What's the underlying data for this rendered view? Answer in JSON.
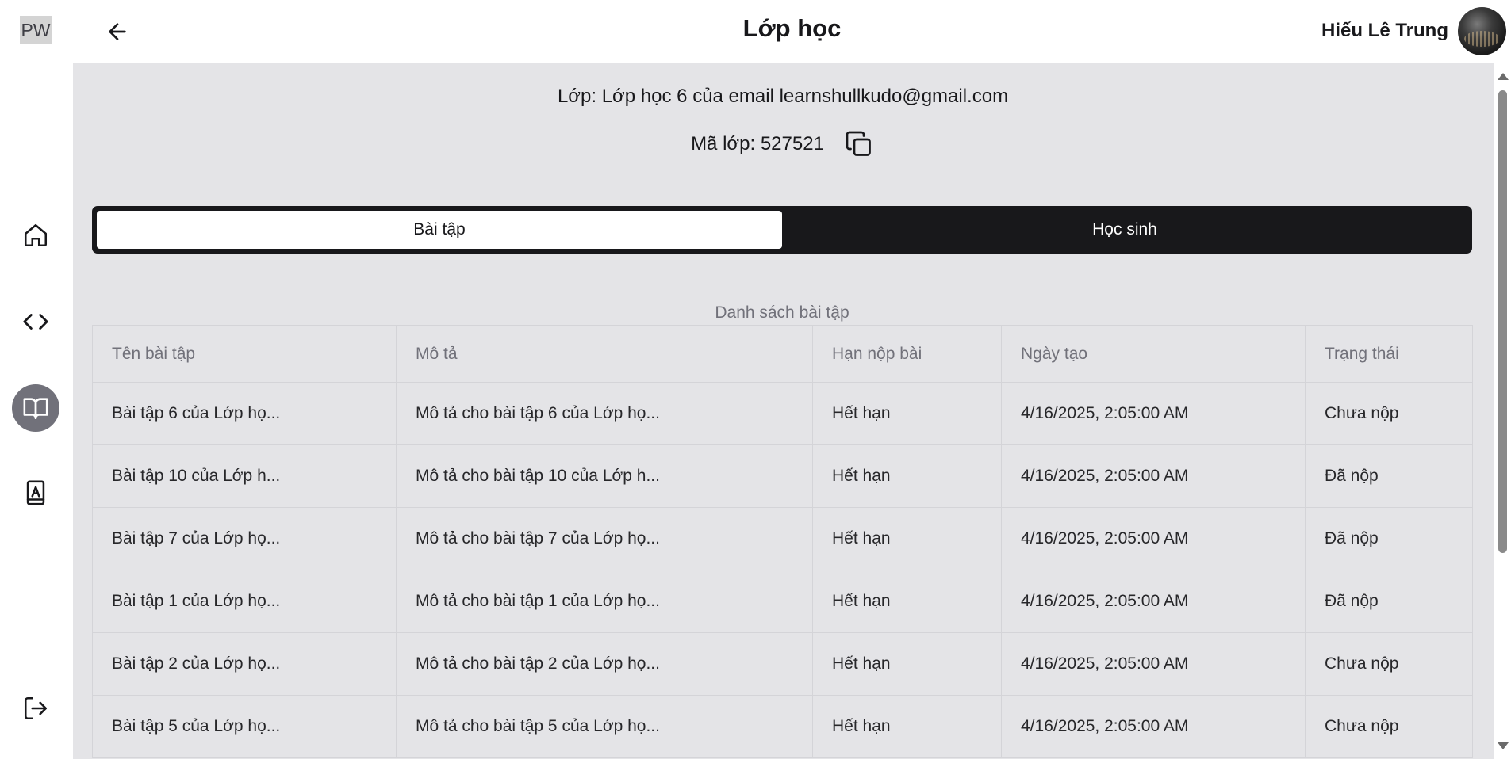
{
  "app": {
    "logo": "PW"
  },
  "header": {
    "title": "Lớp học",
    "user_name": "Hiếu Lê Trung"
  },
  "sidebar": {
    "items": [
      {
        "icon": "home-icon"
      },
      {
        "icon": "code-icon"
      },
      {
        "icon": "book-open-icon",
        "active": true
      },
      {
        "icon": "book-user-icon"
      }
    ],
    "logout_icon": "logout-icon"
  },
  "class_info": {
    "class_line": "Lớp: Lớp học 6 của email learnshullkudo@gmail.com",
    "code_line": "Mã lớp: 527521"
  },
  "tabs": [
    {
      "label": "Bài tập",
      "active": true
    },
    {
      "label": "Học sinh",
      "active": false
    }
  ],
  "table": {
    "caption": "Danh sách bài tập",
    "headers": [
      "Tên bài tập",
      "Mô tả",
      "Hạn nộp bài",
      "Ngày tạo",
      "Trạng thái"
    ],
    "rows": [
      [
        "Bài tập 6 của Lớp họ...",
        "Mô tả cho bài tập 6 của Lớp họ...",
        "Hết hạn",
        "4/16/2025, 2:05:00 AM",
        "Chưa nộp"
      ],
      [
        "Bài tập 10 của Lớp h...",
        "Mô tả cho bài tập 10 của Lớp h...",
        "Hết hạn",
        "4/16/2025, 2:05:00 AM",
        "Đã nộp"
      ],
      [
        "Bài tập 7 của Lớp họ...",
        "Mô tả cho bài tập 7 của Lớp họ...",
        "Hết hạn",
        "4/16/2025, 2:05:00 AM",
        "Đã nộp"
      ],
      [
        "Bài tập 1 của Lớp họ...",
        "Mô tả cho bài tập 1 của Lớp họ...",
        "Hết hạn",
        "4/16/2025, 2:05:00 AM",
        "Đã nộp"
      ],
      [
        "Bài tập 2 của Lớp họ...",
        "Mô tả cho bài tập 2 của Lớp họ...",
        "Hết hạn",
        "4/16/2025, 2:05:00 AM",
        "Chưa nộp"
      ],
      [
        "Bài tập 5 của Lớp họ...",
        "Mô tả cho bài tập 5 của Lớp họ...",
        "Hết hạn",
        "4/16/2025, 2:05:00 AM",
        "Chưa nộp"
      ]
    ]
  },
  "colors": {
    "sidebar_active_bg": "#71717a",
    "content_bg": "#e4e4e7",
    "tabs_bg": "#18181b",
    "muted_text": "#71717a"
  }
}
